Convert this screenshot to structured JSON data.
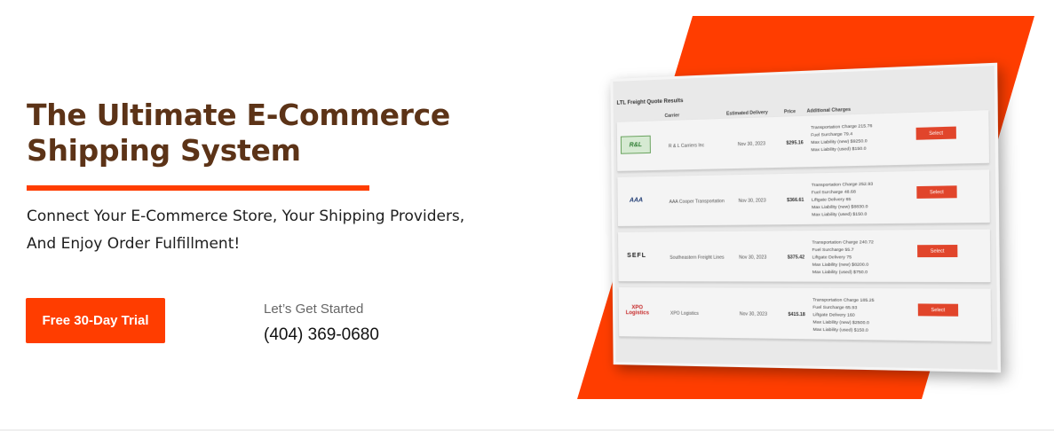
{
  "hero": {
    "headline_line1": "The Ultimate E-Commerce",
    "headline_line2": "Shipping System",
    "subtitle_line1": "Connect Your E-Commerce Store, Your Shipping Providers,",
    "subtitle_line2": "And Enjoy Order Fulfillment!",
    "cta_label": "Free 30-Day Trial",
    "contact_label": "Let’s Get Started",
    "phone": "(404) 369-0680"
  },
  "colors": {
    "brand_orange": "#ff3d00",
    "headline_brown": "#5c3317",
    "select_red": "#e1452b"
  },
  "quote_panel": {
    "title": "LTL Freight Quote Results",
    "headers": {
      "carrier": "Carrier",
      "delivery": "Estimated Delivery",
      "price": "Price",
      "charges": "Additional Charges"
    },
    "rows": [
      {
        "logo_text": "R&L",
        "carrier": "R & L Carriers Inc",
        "date": "Nov 30, 2023",
        "price": "$295.16",
        "charges": [
          "Transportation Charge 215.76",
          "Fuel Surcharge 79.4",
          "Max Liability (new) $9250.0",
          "Max Liability (used) $150.0"
        ],
        "select_label": "Select"
      },
      {
        "logo_text": "AAA",
        "carrier": "AAA Cooper Transportation",
        "date": "Nov 30, 2023",
        "price": "$366.61",
        "charges": [
          "Transportation Charge 252.93",
          "Fuel Surcharge 48.68",
          "Liftgate Delivery 65",
          "Max Liability (new) $8830.0",
          "Max Liability (used) $150.0"
        ],
        "select_label": "Select"
      },
      {
        "logo_text": "SEFL",
        "carrier": "Southeastern Freight Lines",
        "date": "Nov 30, 2023",
        "price": "$375.42",
        "charges": [
          "Transportation Charge 240.72",
          "Fuel Surcharge 55.7",
          "Liftgate Delivery 75",
          "Max Liability (new) $8200.0",
          "Max Liability (used) $750.0"
        ],
        "select_label": "Select"
      },
      {
        "logo_text": "XPO Logistics",
        "carrier": "XPO Logistics",
        "date": "Nov 30, 2023",
        "price": "$415.18",
        "charges": [
          "Transportation Charge 185.25",
          "Fuel Surcharge 65.93",
          "Liftgate Delivery 160",
          "Max Liability (new) $2500.0",
          "Max Liability (used) $150.0"
        ],
        "select_label": "Select"
      }
    ]
  }
}
